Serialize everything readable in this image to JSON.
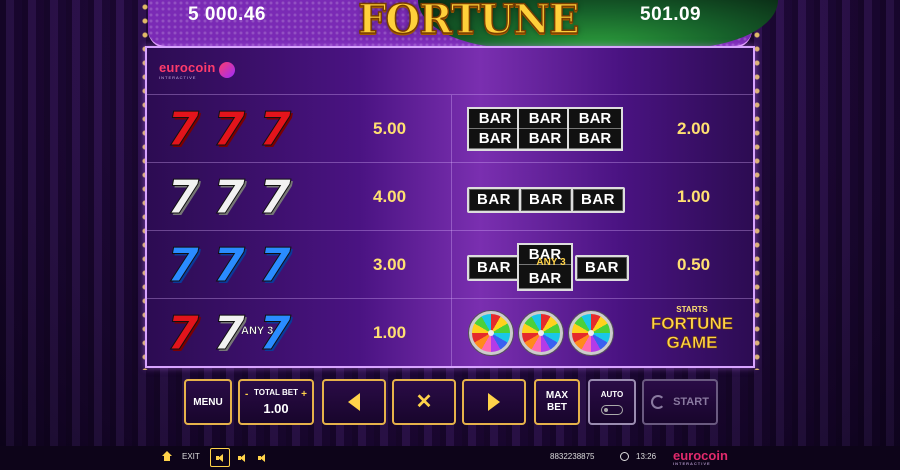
{
  "header": {
    "balance": "5 000.46",
    "win": "501.09",
    "logo_text": "FORTUNE"
  },
  "brand": {
    "name": "eurocoin",
    "sub": "INTERACTIVE"
  },
  "paytable": {
    "left": [
      {
        "symbols": "red-777",
        "glyph": "7",
        "payout": "5.00"
      },
      {
        "symbols": "white-777",
        "glyph": "7",
        "payout": "4.00"
      },
      {
        "symbols": "blue-777",
        "glyph": "7",
        "payout": "3.00"
      },
      {
        "symbols": "any-3-sevens",
        "glyph": "7",
        "label": "ANY 3",
        "payout": "1.00"
      }
    ],
    "right": [
      {
        "symbols": "double-bar",
        "bar_text": "BAR",
        "payout": "2.00"
      },
      {
        "symbols": "single-bar",
        "bar_text": "BAR",
        "payout": "1.00"
      },
      {
        "symbols": "any-3-bars",
        "bar_text": "BAR",
        "label": "ANY 3",
        "payout": "0.50"
      },
      {
        "symbols": "fortune-wheels",
        "starts_label": "STARTS",
        "feature_line1": "FORTUNE",
        "feature_line2": "GAME"
      }
    ]
  },
  "controls": {
    "menu": "MENU",
    "total_bet_label": "TOTAL BET",
    "total_bet_value": "1.00",
    "minus": "-",
    "plus": "+",
    "cancel_glyph": "✕",
    "max_bet_line1": "MAX",
    "max_bet_line2": "BET",
    "auto": "AUTO",
    "start": "START"
  },
  "bottom_bar": {
    "exit": "EXIT",
    "ticket_id": "8832238875",
    "time": "13:26",
    "brand": "eurocoin",
    "brand_sub": "INTERACTIVE"
  },
  "colors": {
    "accent_gold": "#ffd34a",
    "panel_purple": "#4a1382",
    "brand_pink": "#e22a6c"
  },
  "icons": [
    "home-icon",
    "sound-on-icon",
    "sound-mid-icon",
    "sound-mute-icon",
    "clock-icon",
    "spin-icon",
    "arrow-left-icon",
    "arrow-right-icon",
    "close-icon"
  ]
}
